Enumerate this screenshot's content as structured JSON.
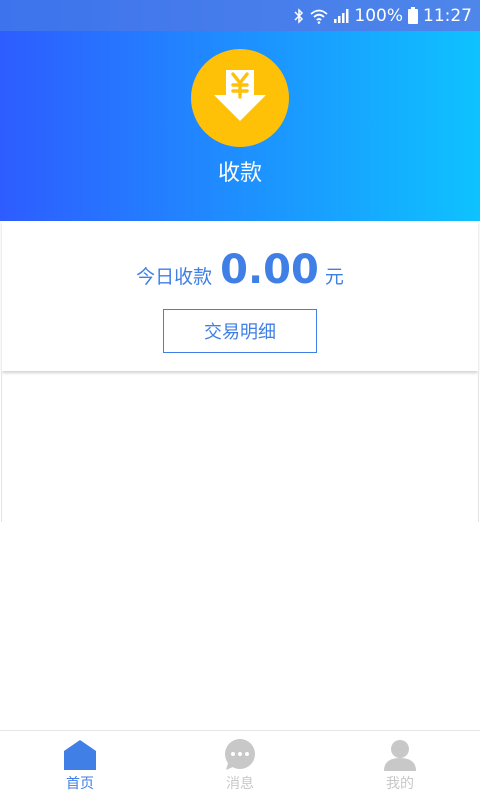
{
  "status_bar": {
    "battery": "100%",
    "time": "11:27",
    "icons": [
      "bluetooth-icon",
      "wifi-icon",
      "signal-icon",
      "battery-icon"
    ]
  },
  "header": {
    "title": "收款",
    "icon": "yuan-download-icon",
    "gradient": [
      "#2e5cff",
      "#0ec2ff"
    ],
    "icon_color": "#ffc107"
  },
  "summary": {
    "today_label": "今日收款",
    "amount": "0.00",
    "unit": "元",
    "detail_button": "交易明细",
    "accent": "#3f7fe6"
  },
  "bottom_nav": {
    "items": [
      {
        "label": "首页",
        "icon": "home-icon",
        "active": true
      },
      {
        "label": "消息",
        "icon": "message-icon",
        "active": false
      },
      {
        "label": "我的",
        "icon": "profile-icon",
        "active": false
      }
    ],
    "active_color": "#3f7fe6",
    "inactive_color": "#c8c8c8"
  }
}
